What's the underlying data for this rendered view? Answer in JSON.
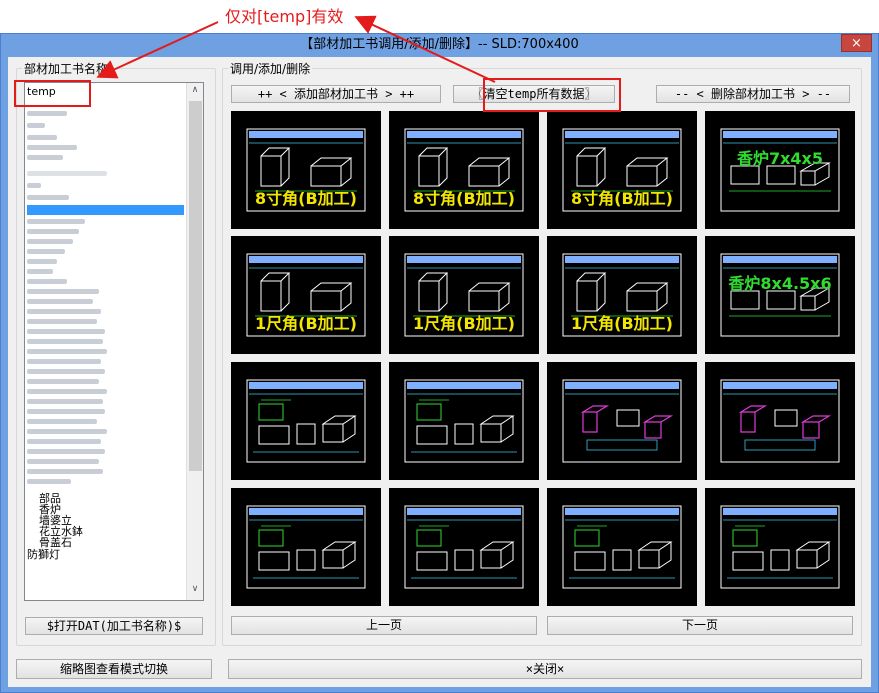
{
  "window": {
    "title": "【部材加工书调用/添加/删除】-- SLD:700x400",
    "close_label": "×"
  },
  "annotation": {
    "text": "仅对[temp]有效",
    "color": "#e31b1b"
  },
  "left_panel": {
    "group_label": "部材加工书名称",
    "selected_entry": "temp",
    "visible_entries": [
      "部品",
      "香炉",
      "墙婆立",
      "花立水鉢",
      "骨盖石",
      "防獅灯"
    ],
    "open_dat_button": "$打开DAT(加工书名称)$",
    "scroll_up": "∧",
    "scroll_down": "∨"
  },
  "right_panel": {
    "group_label": "调用/添加/删除",
    "add_button": "++ < 添加部材加工书 > ++",
    "clear_button": "〖清空temp所有数据〗",
    "delete_button": "-- < 删除部材加工书 > --",
    "thumbnails": [
      {
        "caption": "8寸角(B加工)",
        "kind": "box"
      },
      {
        "caption": "8寸角(B加工)",
        "kind": "box"
      },
      {
        "caption": "8寸角(B加工)",
        "kind": "box"
      },
      {
        "caption": "香炉7x4x5",
        "kind": "incense"
      },
      {
        "caption": "1尺角(B加工)",
        "kind": "box"
      },
      {
        "caption": "1尺角(B加工)",
        "kind": "box"
      },
      {
        "caption": "1尺角(B加工)",
        "kind": "box"
      },
      {
        "caption": "香炉8x4.5x6",
        "kind": "incense"
      },
      {
        "caption": "",
        "kind": "drawing"
      },
      {
        "caption": "",
        "kind": "drawing"
      },
      {
        "caption": "",
        "kind": "magenta"
      },
      {
        "caption": "",
        "kind": "magenta"
      },
      {
        "caption": "",
        "kind": "drawing"
      },
      {
        "caption": "",
        "kind": "drawing"
      },
      {
        "caption": "",
        "kind": "drawing"
      },
      {
        "caption": "",
        "kind": "drawing"
      }
    ],
    "prev_button": "上一页",
    "next_button": "下一页"
  },
  "footer": {
    "toggle_button": "缩略图查看模式切换",
    "close_button": "×关闭×"
  },
  "colors": {
    "window_frame": "#6fa1e2",
    "highlight_red": "#e31b1b",
    "cad_yellow": "#f2e600",
    "cad_cyan": "#39c4e6",
    "cad_green": "#2fdc2f",
    "cad_magenta": "#e03ad8",
    "list_selection": "#3399ff"
  }
}
